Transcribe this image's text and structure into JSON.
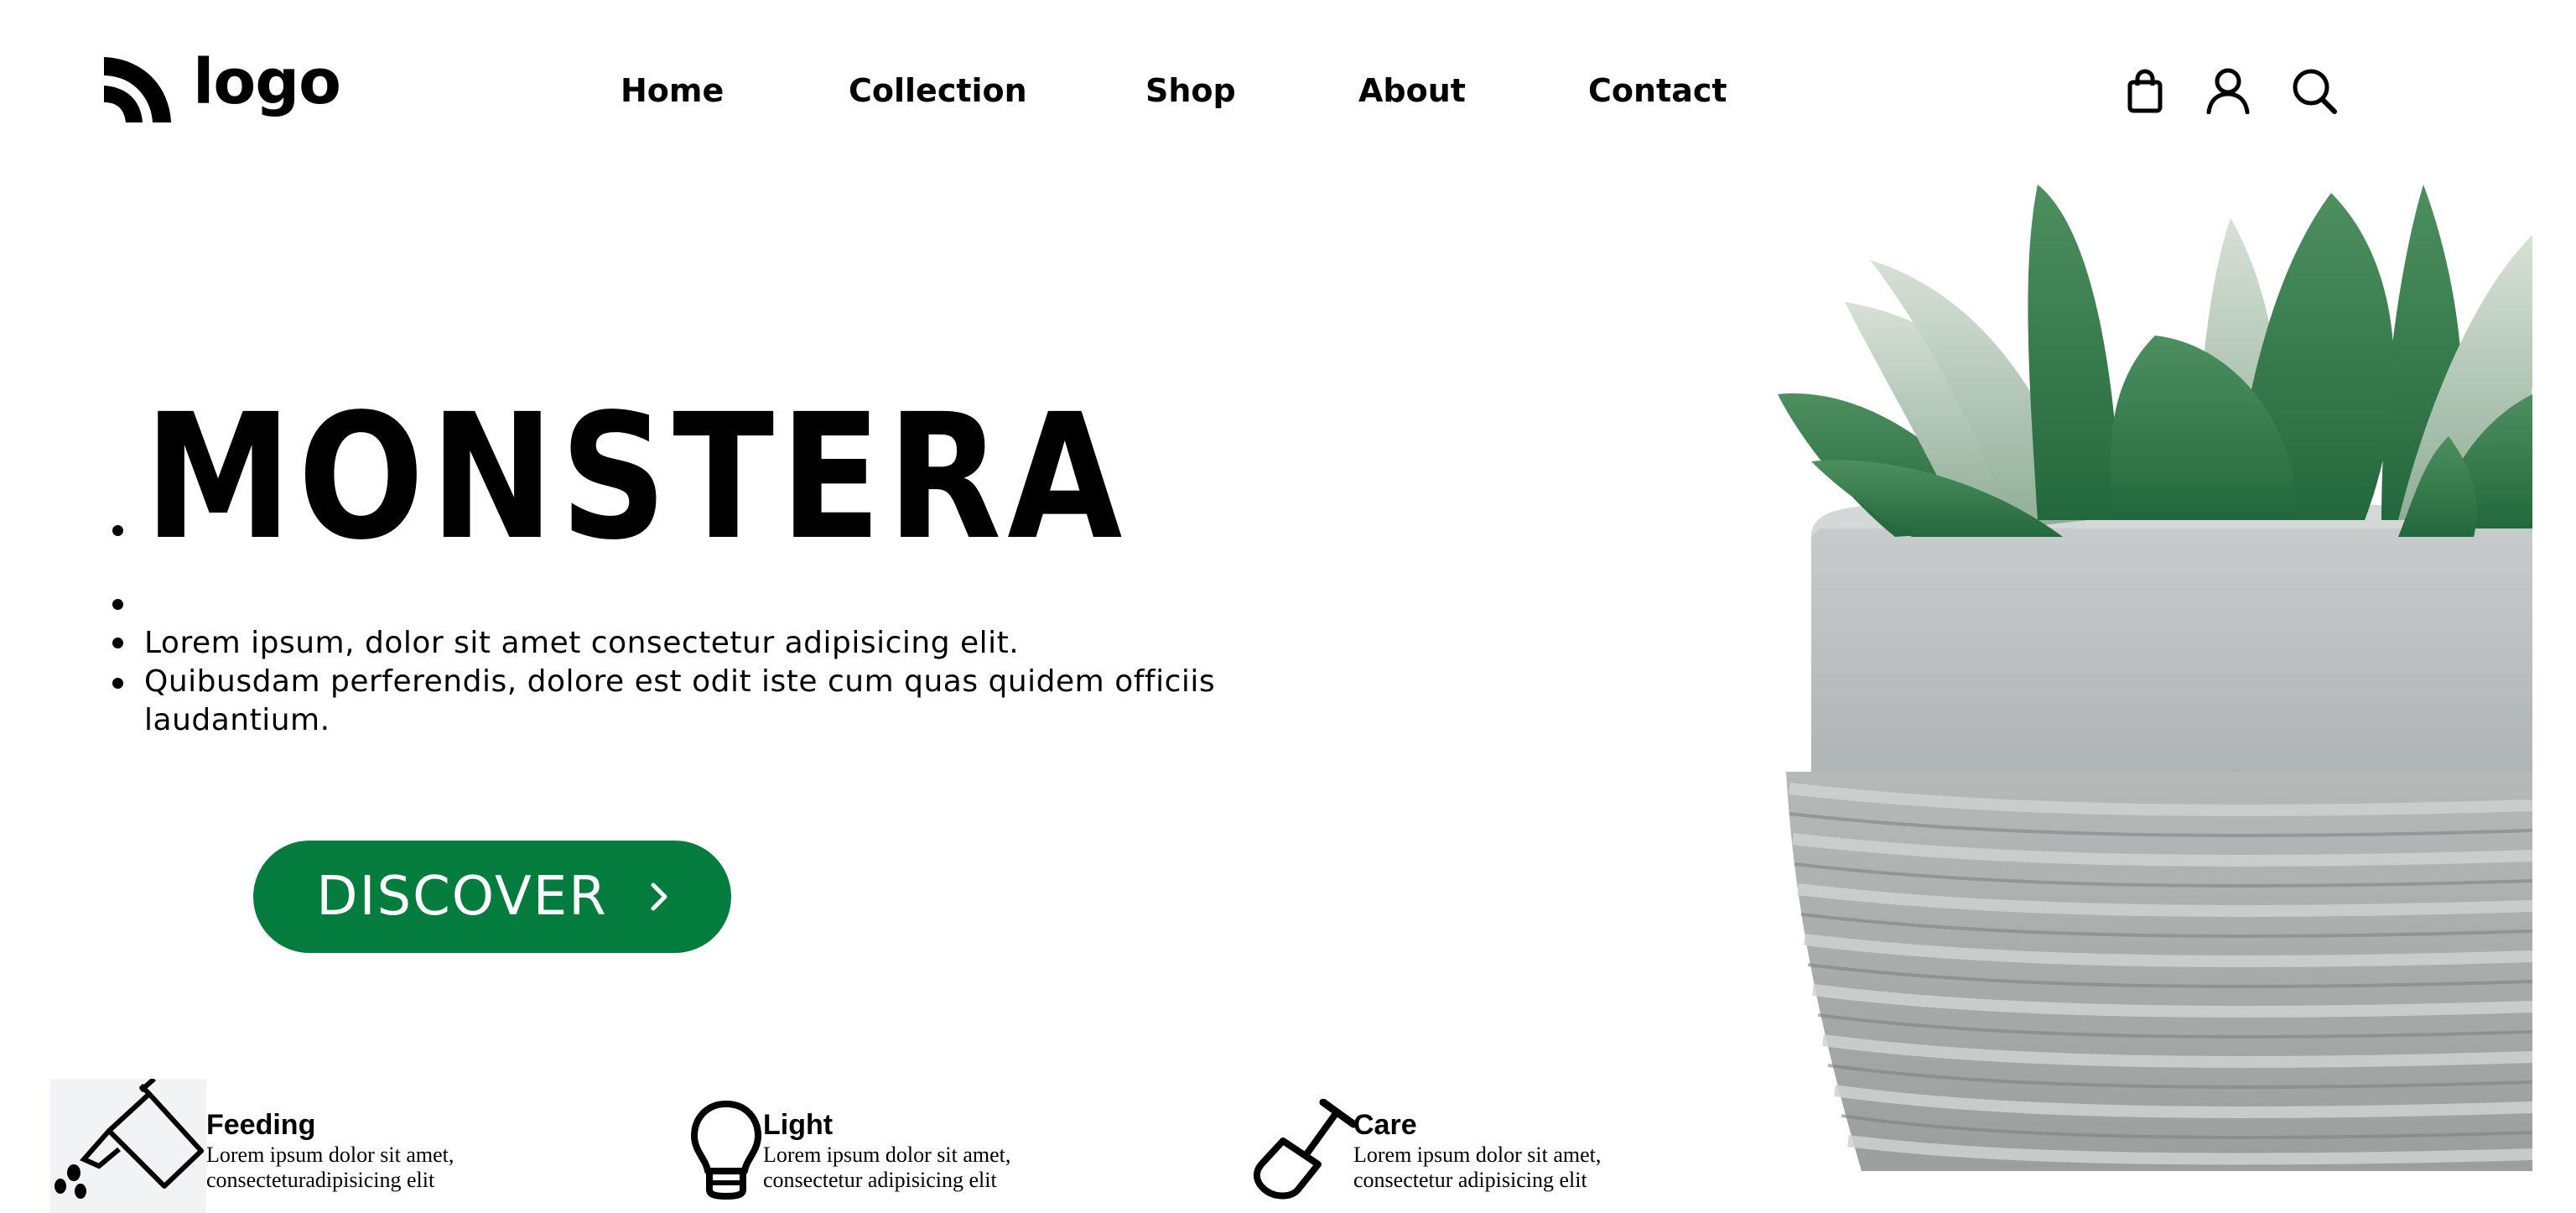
{
  "header": {
    "logo_text": "logo",
    "nav": [
      "Home",
      "Collection",
      "Shop",
      "About",
      "Contact"
    ],
    "icons": [
      "shopping-bag-icon",
      "user-icon",
      "search-icon"
    ]
  },
  "hero": {
    "title": "MONSTERA",
    "descriptions": [
      "Lorem ipsum, dolor sit amet consectetur adipisicing elit.",
      "Quibusdam perferendis, dolore est odit iste cum quas quidem officiis",
      "laudantium."
    ],
    "button_label": "DISCOVER"
  },
  "features": [
    {
      "icon": "watering-can-icon",
      "title": "Feeding",
      "line1": "Lorem ipsum dolor sit amet,",
      "line2": "consecteturadipisicing elit"
    },
    {
      "icon": "lightbulb-icon",
      "title": "Light",
      "line1": "Lorem ipsum dolor sit amet,",
      "line2": "consectetur adipisicing elit"
    },
    {
      "icon": "shovel-icon",
      "title": "Care",
      "line1": "Lorem ipsum dolor sit amet,",
      "line2": "consectetur adipisicing elit"
    }
  ],
  "colors": {
    "accent_green": "#047c3e",
    "text": "#000000",
    "background": "#ffffff"
  }
}
